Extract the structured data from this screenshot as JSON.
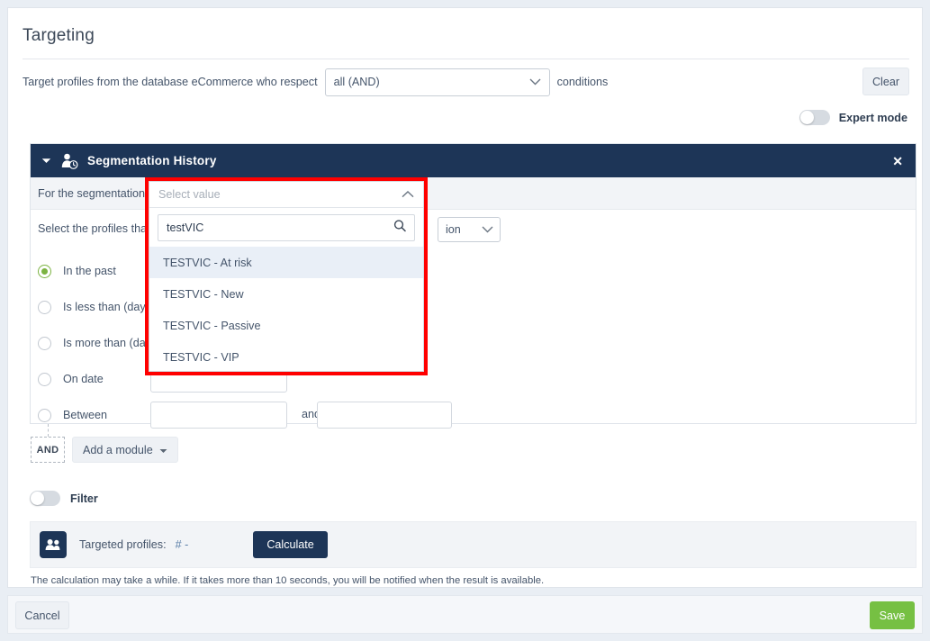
{
  "page": {
    "title": "Targeting"
  },
  "targeting": {
    "prefix_text": "Target profiles from the database eCommerce who respect",
    "condition_value": "all (AND)",
    "suffix_text": "conditions",
    "clear_label": "Clear"
  },
  "expert": {
    "label": "Expert mode",
    "enabled": false
  },
  "module": {
    "title": "Segmentation History",
    "icon": "user-history-icon",
    "collapse_icon": "caret-down-icon",
    "close_icon": "close-icon",
    "segmentation_row_label": "For the segmentation",
    "profiles_row_label": "Select the profiles that",
    "action_value": "ion",
    "options": [
      {
        "label": "In the past",
        "selected": true
      },
      {
        "label": "Is less than (days)",
        "selected": false
      },
      {
        "label": "Is more than (days)",
        "selected": false
      },
      {
        "label": "On date",
        "selected": false
      },
      {
        "label": "Between",
        "selected": false
      }
    ],
    "between_and_label": "and",
    "on_date_value": "",
    "between_from_value": "",
    "between_to_value": ""
  },
  "dropdown": {
    "placeholder": "Select value",
    "search_value": "testVIC",
    "search_icon": "search-icon",
    "caret_icon": "chevron-up-icon",
    "items": [
      {
        "label": "TESTVIC - At risk",
        "highlighted": true
      },
      {
        "label": "TESTVIC - New",
        "highlighted": false
      },
      {
        "label": "TESTVIC - Passive",
        "highlighted": false
      },
      {
        "label": "TESTVIC - VIP",
        "highlighted": false
      }
    ]
  },
  "builder": {
    "and_tag": "AND",
    "add_module_label": "Add a module"
  },
  "filter": {
    "label": "Filter",
    "enabled": false
  },
  "targeted": {
    "icon": "users-icon",
    "label": "Targeted profiles:",
    "count": "# -",
    "calculate_label": "Calculate",
    "note": "The calculation may take a while. If it takes more than 10 seconds, you will be notified when the result is available."
  },
  "footer": {
    "cancel_label": "Cancel",
    "save_label": "Save"
  },
  "colors": {
    "navy": "#1d3557",
    "green": "#76c043",
    "radio_green": "#7cb342",
    "highlight_red": "#ff0000",
    "page_bg": "#e9eef4"
  }
}
